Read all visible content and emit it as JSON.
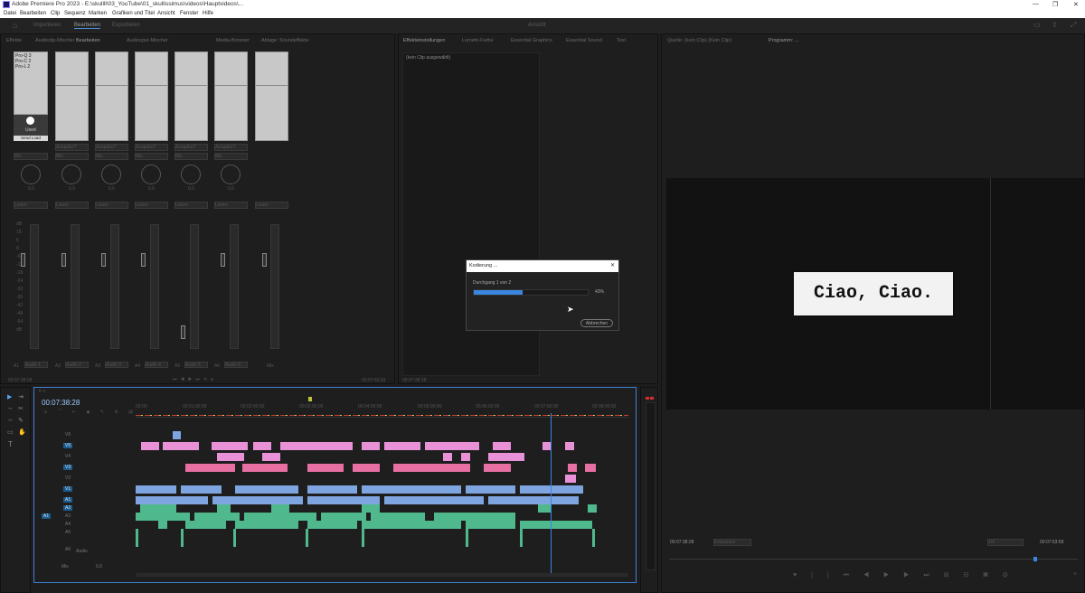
{
  "titlebar": {
    "title": "Adobe Premiere Pro 2023 - E:\\skullll\\03_YouTube\\01_skullissimus\\videos\\Hauptvideos\\...",
    "minimize": "—",
    "restore": "❐",
    "close": "✕"
  },
  "menu": [
    "Datei",
    "Bearbeiten",
    "Clip",
    "Sequenz",
    "Marken",
    "Grafiken und Titel",
    "Ansicht",
    "Fenster",
    "Hilfe"
  ],
  "workspaces": {
    "home": "⌂",
    "items": [
      "Importieren",
      "Bearbeiten",
      "Exportieren"
    ],
    "active_index": 1,
    "center": "Ansicht"
  },
  "mixer_panel": {
    "tabs": [
      "Effekte",
      "Audioclip-Mischer",
      "Bearbeiten",
      "Audiospur-Mischer",
      "Media-Browser",
      "Ablage: Soundeffekte"
    ],
    "active_tab": 1,
    "presets": [
      "Pro-Q 3",
      "Pro-C 2",
      "Pro-L 2"
    ],
    "knob_label": "Used",
    "send_label": "Send Load",
    "send_options": [
      "Ausgabe?",
      "Ausgabe?",
      "Ausgabe?",
      "Ausgabe?",
      "Ausgabe?",
      "Ausgabe?"
    ],
    "mix_label": "Mix",
    "read_label": "Lesen",
    "db_ticks": [
      "dB",
      "15",
      "6",
      "0",
      "-6",
      "-12",
      "-18",
      "-24",
      "-30",
      "-36",
      "-42",
      "-48",
      "-54",
      "dB"
    ],
    "db_value": "0,0",
    "channels": [
      "A1",
      "A2",
      "A3",
      "A4",
      "A5",
      "A6",
      "Mix"
    ],
    "channel_names": [
      "Audio 1",
      "Audio 2",
      "Audio 3",
      "Audio 4",
      "Audio 5",
      "Audio 6",
      "Mix"
    ],
    "timecode_left": "00:07:38:28",
    "timecode_right": "00:07:53:59"
  },
  "effect_panel": {
    "tabs": [
      "Effekteinstellungen",
      "Lumetri-Farbe",
      "Essential Graphics",
      "Essential Sound",
      "Text"
    ],
    "active_tab": 0,
    "no_clip": "(kein Clip ausgewählt)",
    "timecode": "00:07:38:28"
  },
  "source_panel": {
    "tabs": [
      "Quelle: (kein Clip) (Kein Clip)",
      "Programm: ..."
    ],
    "timecode_left": "00:07:38:28",
    "fit": "Einpassen",
    "ratio": "1/4",
    "timecode_right": "00:07:53:59",
    "caption": "Ciao, Ciao."
  },
  "timeline": {
    "timecode": "00:07:38:28",
    "ruler": [
      "00:00",
      "00:01:00:00",
      "00:02:00:00",
      "00:03:00:00",
      "00:04:00:00",
      "00:05:00:00",
      "00:06:00:00",
      "00:07:00:00",
      "00:08:00:00"
    ],
    "video_tracks": [
      "V6",
      "V5",
      "V4",
      "V3",
      "V2",
      "V1"
    ],
    "audio_tracks": [
      "A1",
      "A2",
      "A3",
      "A4",
      "A5",
      "A6"
    ],
    "master_label": "Audio",
    "mix_label": "Mix",
    "mix_value": "0,0",
    "source_target": "A1",
    "playhead_percent": 85
  },
  "dialog": {
    "title": "Kodierung ...",
    "close": "✕",
    "status": "Durchgang 1 von 2",
    "progress_percent": 43,
    "progress_label": "43%",
    "cancel": "Abbrechen"
  },
  "tools": [
    "▶",
    "⇥",
    "✂",
    "↔",
    "✎",
    "✋",
    "T"
  ]
}
